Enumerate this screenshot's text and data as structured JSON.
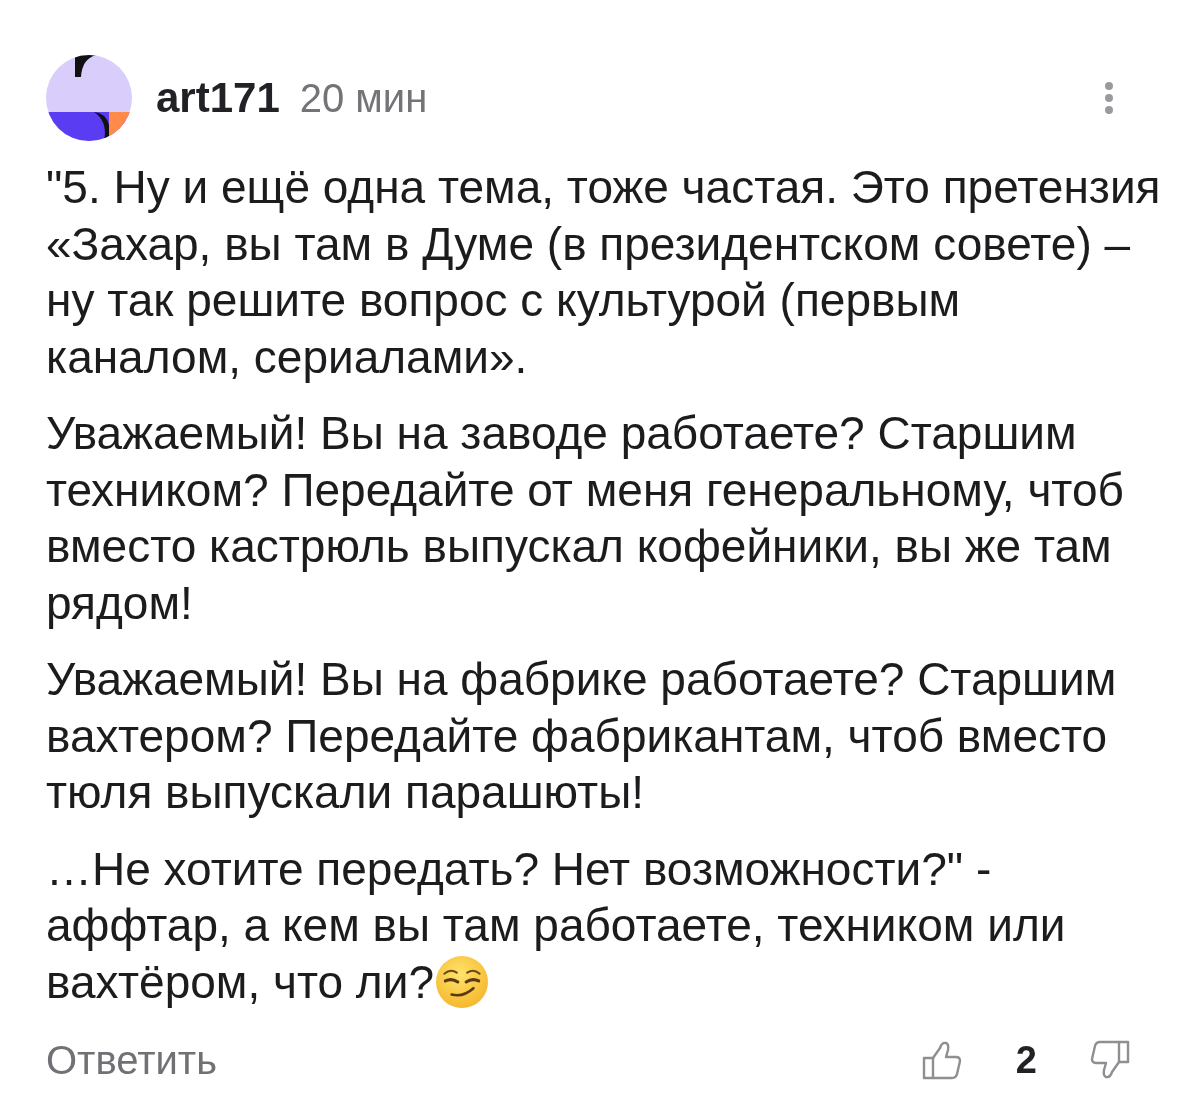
{
  "comment": {
    "author": "art171",
    "time": "20 мин",
    "paragraphs": [
      "\"5. Ну и ещё одна тема, тоже частая. Это претензия «Захар, вы там в Думе (в президентском совете) – ну так решите вопрос с культурой (первым каналом, сериалами».",
      "Уважаемый! Вы на заводе работаете? Старшим техником? Передайте от меня генеральному, чтоб вместо кастрюль выпускал кофейники, вы же там рядом!",
      "Уважаемый! Вы на фабрике работаете? Старшим вахтером? Передайте фабрикантам, чтоб вместо тюля выпускали парашюты!",
      "…Не хотите передать? Нет возможности?\" - аффтар, а кем вы там работаете, техником или вахтёром, что ли?"
    ]
  },
  "actions": {
    "reply": "Ответить",
    "likes": "2"
  }
}
